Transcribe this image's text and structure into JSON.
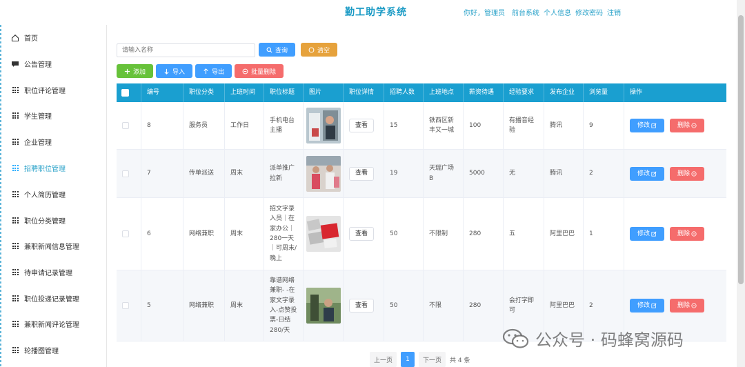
{
  "header": {
    "title": "勤工助学系统",
    "links": [
      "你好，管理员",
      "前台系统",
      "个人信息",
      "修改密码",
      "注销"
    ]
  },
  "sidebar": {
    "items": [
      {
        "label": "首页",
        "icon": "home-icon"
      },
      {
        "label": "公告管理",
        "icon": "comment-icon"
      },
      {
        "label": "职位评论管理",
        "icon": "grid-icon"
      },
      {
        "label": "学生管理",
        "icon": "grid-icon"
      },
      {
        "label": "企业管理",
        "icon": "grid-icon"
      },
      {
        "label": "招聘职位管理",
        "icon": "grid-icon",
        "active": true
      },
      {
        "label": "个人简历管理",
        "icon": "grid-icon"
      },
      {
        "label": "职位分类管理",
        "icon": "grid-icon"
      },
      {
        "label": "兼职新闻信息管理",
        "icon": "grid-icon"
      },
      {
        "label": "待申请记录管理",
        "icon": "grid-icon"
      },
      {
        "label": "职位投递记录管理",
        "icon": "grid-icon"
      },
      {
        "label": "兼职新闻评论管理",
        "icon": "grid-icon"
      },
      {
        "label": "轮播图管理",
        "icon": "grid-icon"
      }
    ]
  },
  "search": {
    "placeholder": "请输入名称",
    "query_label": "查询",
    "clear_label": "清空"
  },
  "toolbar": {
    "add_label": "添加",
    "import_label": "导入",
    "export_label": "导出",
    "bulk_delete_label": "批量删除"
  },
  "table": {
    "columns": [
      "编号",
      "职位分类",
      "上班时间",
      "职位标题",
      "图片",
      "职位详情",
      "招聘人数",
      "上班地点",
      "薪资待遇",
      "经验要求",
      "发布企业",
      "浏览量",
      "操作"
    ],
    "view_label": "查看",
    "edit_label": "修改",
    "delete_label": "删除",
    "rows": [
      {
        "id": "8",
        "category": "服务员",
        "work_time": "工作日",
        "title": "手机电台主播",
        "count": "15",
        "location": "铁西区新丰又一城",
        "salary": "100",
        "experience": "有播音经验",
        "company": "腾讯",
        "views": "9"
      },
      {
        "id": "7",
        "category": "传单派送",
        "work_time": "周末",
        "title": "派单推广拉新",
        "count": "19",
        "location": "天瑞广场B",
        "salary": "5000",
        "experience": "无",
        "company": "腾讯",
        "views": "2"
      },
      {
        "id": "6",
        "category": "网络兼职",
        "work_time": "周末",
        "title": "招文字录入员｜在家办公｜280一天｜可周末/晚上",
        "count": "50",
        "location": "不限制",
        "salary": "280",
        "experience": "五",
        "company": "阿里巴巴",
        "views": "1"
      },
      {
        "id": "5",
        "category": "网络兼职",
        "work_time": "周末",
        "title": "靠谱网络兼职- -在家文字录入-点赞投票-日结280/天",
        "count": "50",
        "location": "不限",
        "salary": "280",
        "experience": "会打字即可",
        "company": "阿里巴巴",
        "views": "2"
      }
    ]
  },
  "pagination": {
    "prev": "上一页",
    "current": "1",
    "next": "下一页",
    "total": "共 4 条"
  },
  "watermark": "公众号 · 码蜂窝源码",
  "colors": {
    "header_bar": "#1a9fd0",
    "primary": "#409eff",
    "success": "#67c23a",
    "warning": "#e6a23c",
    "danger": "#f56c6c",
    "title": "#1c9bc5"
  }
}
